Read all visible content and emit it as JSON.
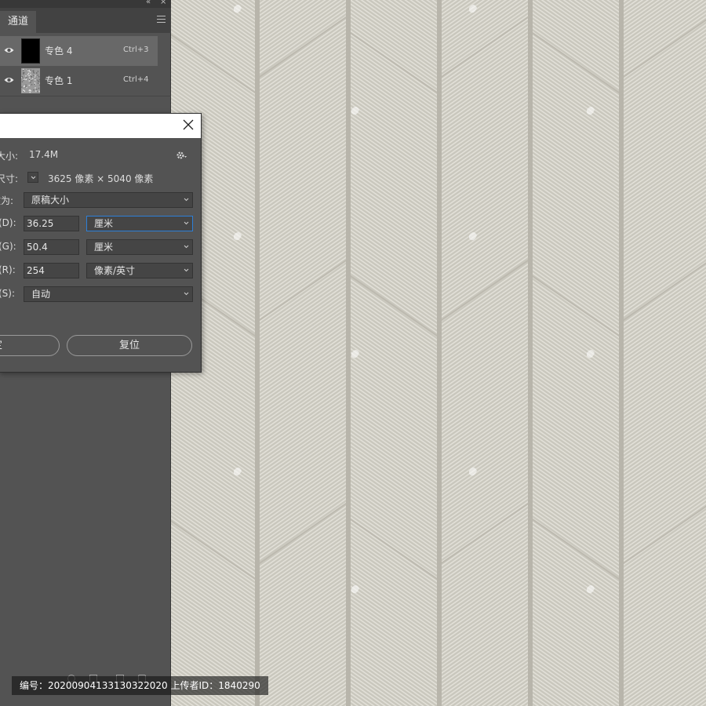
{
  "panel": {
    "tab_label": "通道",
    "channels": [
      {
        "name": "专色 4",
        "shortcut": "Ctrl+3",
        "selected": true,
        "thumbnail": "black"
      },
      {
        "name": "专色 1",
        "shortcut": "Ctrl+4",
        "selected": false,
        "thumbnail": "texture"
      }
    ]
  },
  "dialog": {
    "size_label": "大小:",
    "size_value": "17.4M",
    "dim_label": "尺寸:",
    "dim_value": "3625 像素 × 5040 像素",
    "fit_label": "缩放为:",
    "fit_value": "原稿大小",
    "width_label": "(D):",
    "width_value": "36.25",
    "width_unit": "厘米",
    "height_label": "(G):",
    "height_value": "50.4",
    "height_unit": "厘米",
    "res_label": "(R):",
    "res_value": "254",
    "res_unit": "像素/英寸",
    "resample_label": "(S):",
    "resample_value": "自动",
    "ok_label": "定",
    "reset_label": "复位"
  },
  "watermark": {
    "text": "编号：20200904133130322020 上传者ID：1840290"
  },
  "colors": {
    "canvas_bg": "#c8c6bc",
    "stripe_line": "#b6b3a9",
    "diagonal_line": "#dedcd3",
    "panel_bg": "#535353",
    "accent_focus": "#2d7fd6"
  },
  "icons": [
    "eye-icon",
    "gear-icon",
    "close-icon",
    "chevron-down-icon",
    "panel-menu-icon",
    "collapse-icon"
  ]
}
